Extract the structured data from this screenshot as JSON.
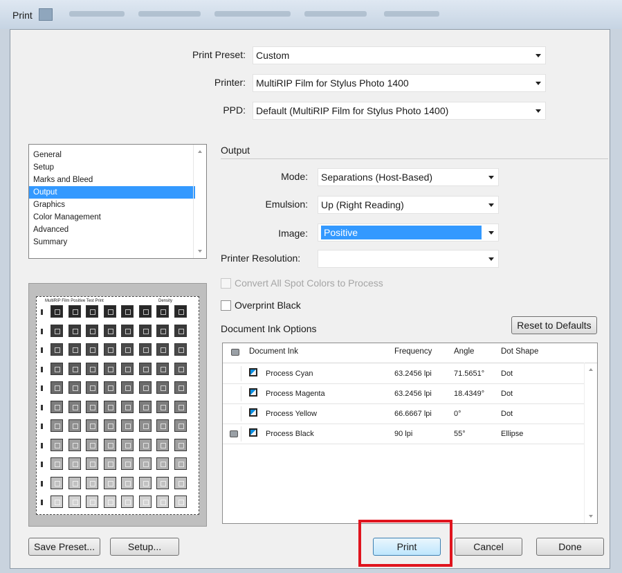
{
  "window": {
    "title": "Print"
  },
  "presets": {
    "print_preset": {
      "label": "Print Preset:",
      "value": "Custom"
    },
    "printer": {
      "label": "Printer:",
      "value": "MultiRIP Film for Stylus Photo 1400"
    },
    "ppd": {
      "label": "PPD:",
      "value": "Default (MultiRIP Film for Stylus Photo 1400)"
    }
  },
  "categories": {
    "items": [
      "General",
      "Setup",
      "Marks and Bleed",
      "Output",
      "Graphics",
      "Color Management",
      "Advanced",
      "Summary"
    ],
    "selected": "Output"
  },
  "output": {
    "section_title": "Output",
    "mode": {
      "label": "Mode:",
      "value": "Separations (Host-Based)"
    },
    "emulsion": {
      "label": "Emulsion:",
      "value": "Up (Right Reading)"
    },
    "image": {
      "label": "Image:",
      "value": "Positive"
    },
    "printer_resolution": {
      "label": "Printer Resolution:",
      "value": ""
    },
    "convert_spot": {
      "label": "Convert All Spot Colors to Process",
      "checked": false,
      "enabled": false
    },
    "overprint_black": {
      "label": "Overprint Black",
      "checked": false,
      "enabled": true
    }
  },
  "ink_options": {
    "title": "Document Ink Options",
    "reset_button": "Reset to Defaults",
    "columns": [
      "Document Ink",
      "Frequency",
      "Angle",
      "Dot Shape"
    ],
    "rows": [
      {
        "name": "Process Cyan",
        "frequency": "63.2456 lpi",
        "angle": "71.5651°",
        "dot_shape": "Dot",
        "print": false
      },
      {
        "name": "Process Magenta",
        "frequency": "63.2456 lpi",
        "angle": "18.4349°",
        "dot_shape": "Dot",
        "print": false
      },
      {
        "name": "Process Yellow",
        "frequency": "66.6667 lpi",
        "angle": "0°",
        "dot_shape": "Dot",
        "print": false
      },
      {
        "name": "Process Black",
        "frequency": "90 lpi",
        "angle": "55°",
        "dot_shape": "Ellipse",
        "print": true
      }
    ]
  },
  "preview": {
    "title": "MultiRIP Film Positive Test Print",
    "density_label": "Density"
  },
  "buttons": {
    "save_preset": "Save Preset...",
    "setup": "Setup...",
    "print": "Print",
    "cancel": "Cancel",
    "done": "Done"
  },
  "accent_color": "#3399ff",
  "highlight_color": "#e0141e"
}
